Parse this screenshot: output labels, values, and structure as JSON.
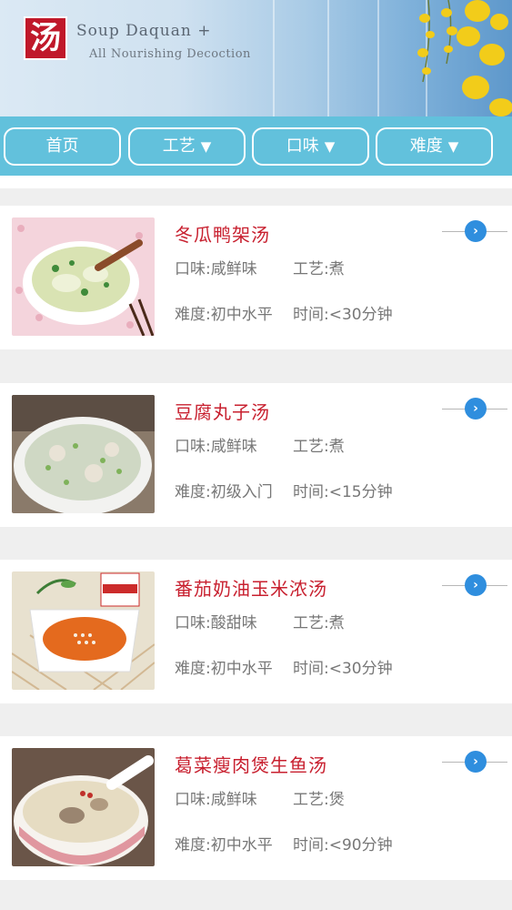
{
  "header": {
    "logo_char": "汤",
    "brand_title": "Soup Daquan +",
    "brand_subtitle": "All Nourishing Decoction"
  },
  "nav": {
    "home": "首页",
    "technique": "工艺",
    "flavor": "口味",
    "difficulty": "难度",
    "dropdown_glyph": "▼"
  },
  "colors": {
    "nav_bar": "#62c1dc",
    "title_red": "#c8202f",
    "arrow_blue": "#2f8ede"
  },
  "recipes": [
    {
      "title": "冬瓜鸭架汤",
      "flavor": "口味:咸鲜味",
      "technique": "工艺:煮",
      "difficulty": "难度:初中水平",
      "time": "时间:<30分钟",
      "thumb_icon": "winter-melon-duck-soup-photo"
    },
    {
      "title": "豆腐丸子汤",
      "flavor": "口味:咸鲜味",
      "technique": "工艺:煮",
      "difficulty": "难度:初级入门",
      "time": "时间:<15分钟",
      "thumb_icon": "tofu-meatball-soup-photo"
    },
    {
      "title": "番茄奶油玉米浓汤",
      "flavor": "口味:酸甜味",
      "technique": "工艺:煮",
      "difficulty": "难度:初中水平",
      "time": "时间:<30分钟",
      "thumb_icon": "tomato-cream-corn-soup-photo"
    },
    {
      "title": "葛菜瘦肉煲生鱼汤",
      "flavor": "口味:咸鲜味",
      "technique": "工艺:煲",
      "difficulty": "难度:初中水平",
      "time": "时间:<90分钟",
      "thumb_icon": "snakehead-fish-soup-photo"
    }
  ],
  "arrow_glyph": "›"
}
